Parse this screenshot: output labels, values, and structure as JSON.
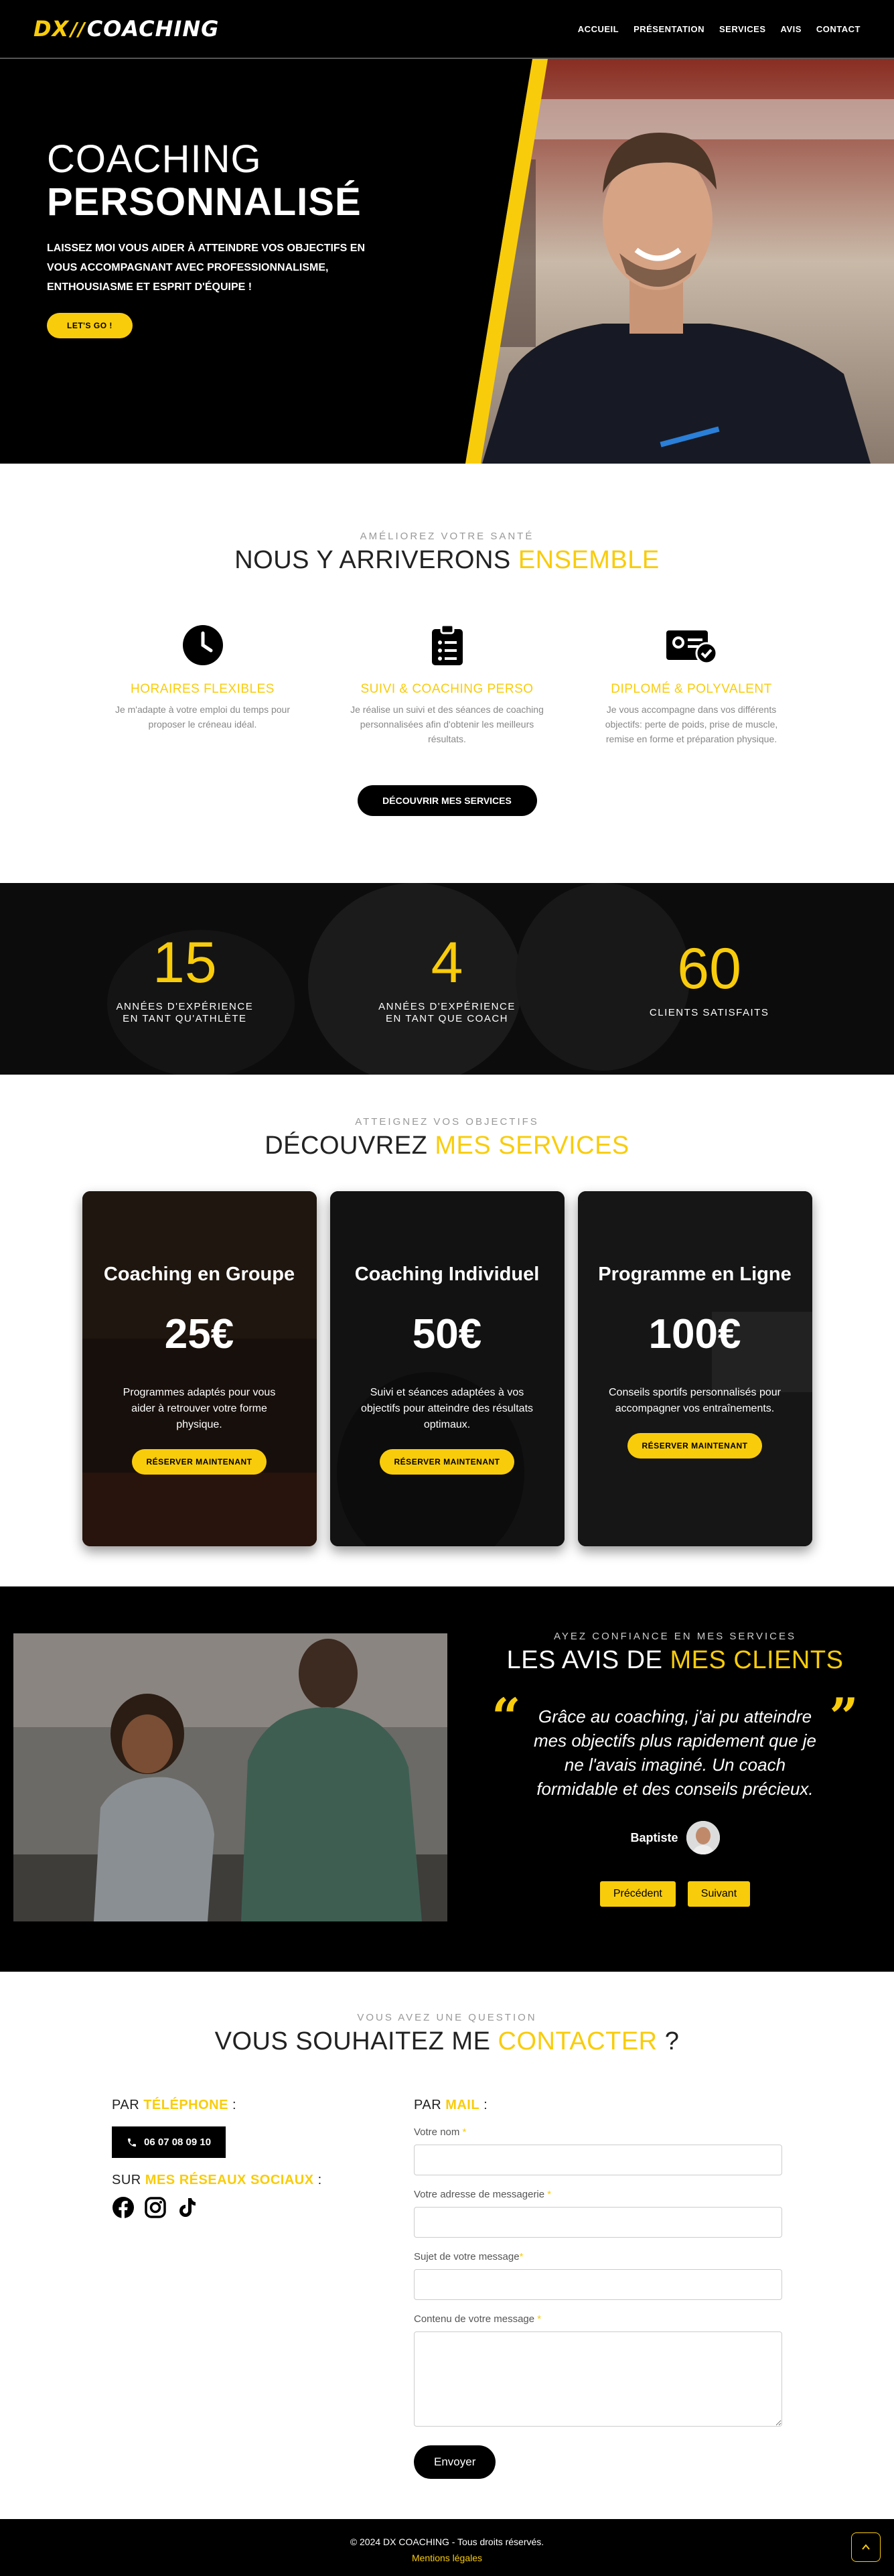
{
  "header": {
    "logo_dx": "DX",
    "logo_coaching": "COACHING",
    "nav": [
      "ACCUEIL",
      "PRÉSENTATION",
      "SERVICES",
      "AVIS",
      "CONTACT"
    ]
  },
  "hero": {
    "title_light": "COACHING",
    "title_bold": "PERSONNALISÉ",
    "text": "LAISSEZ MOI VOUS AIDER À ATTEINDRE VOS OBJECTIFS EN VOUS ACCOMPAGNANT AVEC PROFESSIONNALISME, ENTHOUSIASME ET ESPRIT D'ÉQUIPE !",
    "cta": "LET'S GO !"
  },
  "features": {
    "kicker": "AMÉLIOREZ VOTRE SANTÉ",
    "title_main": "NOUS Y ARRIVERONS",
    "title_accent": "ENSEMBLE",
    "items": [
      {
        "title": "HORAIRES FLEXIBLES",
        "text": "Je m'adapte à votre emploi du temps pour proposer le créneau idéal.",
        "icon": "clock-icon"
      },
      {
        "title": "SUIVI & COACHING PERSO",
        "text": "Je réalise un suivi et des séances de coaching personnalisées afin d'obtenir les meilleurs résultats.",
        "icon": "clipboard-list-icon"
      },
      {
        "title": "DIPLOMÉ & POLYVALENT",
        "text": "Je vous accompagne dans vos différents objectifs: perte de poids, prise de muscle, remise en forme et préparation physique.",
        "icon": "certificate-icon"
      }
    ],
    "cta": "DÉCOUVRIR MES SERVICES"
  },
  "stats": [
    {
      "value": "15",
      "label_line1": "ANNÉES D'EXPÉRIENCE",
      "label_line2": "EN TANT QU'ATHLÈTE"
    },
    {
      "value": "4",
      "label_line1": "ANNÉES D'EXPÉRIENCE",
      "label_line2": "EN TANT QUE COACH"
    },
    {
      "value": "60",
      "label_line1": "CLIENTS SATISFAITS",
      "label_line2": ""
    }
  ],
  "services": {
    "kicker": "ATTEIGNEZ VOS OBJECTIFS",
    "title_main": "DÉCOUVREZ",
    "title_accent": "MES SERVICES",
    "cards": [
      {
        "title": "Coaching en Groupe",
        "price": "25€",
        "text": "Programmes adaptés pour vous aider à retrouver votre forme physique.",
        "cta": "RÉSERVER MAINTENANT"
      },
      {
        "title": "Coaching Individuel",
        "price": "50€",
        "text": "Suivi et séances adaptées à vos objectifs pour atteindre des résultats optimaux.",
        "cta": "RÉSERVER MAINTENANT"
      },
      {
        "title": "Programme en Ligne",
        "price": "100€",
        "text": "Conseils sportifs personnalisés pour accompagner vos entraînements.",
        "cta": "RÉSERVER MAINTENANT"
      }
    ]
  },
  "reviews": {
    "kicker": "AYEZ CONFIANCE EN MES SERVICES",
    "title_main": "LES AVIS DE",
    "title_accent": "MES CLIENTS",
    "quote": "Grâce au coaching, j'ai pu atteindre mes objectifs plus rapidement que je ne l'avais imaginé. Un coach formidable et des conseils précieux.",
    "author": "Baptiste",
    "prev": "Précédent",
    "next": "Suivant"
  },
  "contact": {
    "kicker": "VOUS AVEZ UNE QUESTION",
    "title_main": "VOUS SOUHAITEZ ME",
    "title_accent": "CONTACTER",
    "title_end": "?",
    "phone_prefix": "PAR",
    "phone_accent": "TÉLÉPHONE",
    "phone_suffix": ":",
    "phone": "06 07 08 09 10",
    "social_prefix": "SUR",
    "social_accent": "MES RÉSEAUX SOCIAUX",
    "social_suffix": ":",
    "mail_prefix": "PAR",
    "mail_accent": "MAIL",
    "mail_suffix": ":",
    "fields": {
      "name": "Votre nom",
      "email": "Votre adresse de messagerie",
      "subject": "Sujet de votre message",
      "message": "Contenu de votre message"
    },
    "required_mark": "*",
    "send": "Envoyer"
  },
  "footer": {
    "copyright": "© 2024 DX COACHING - Tous droits réservés.",
    "legal": "Mentions légales"
  },
  "colors": {
    "accent": "#f9cc0b",
    "dark": "#000000"
  }
}
